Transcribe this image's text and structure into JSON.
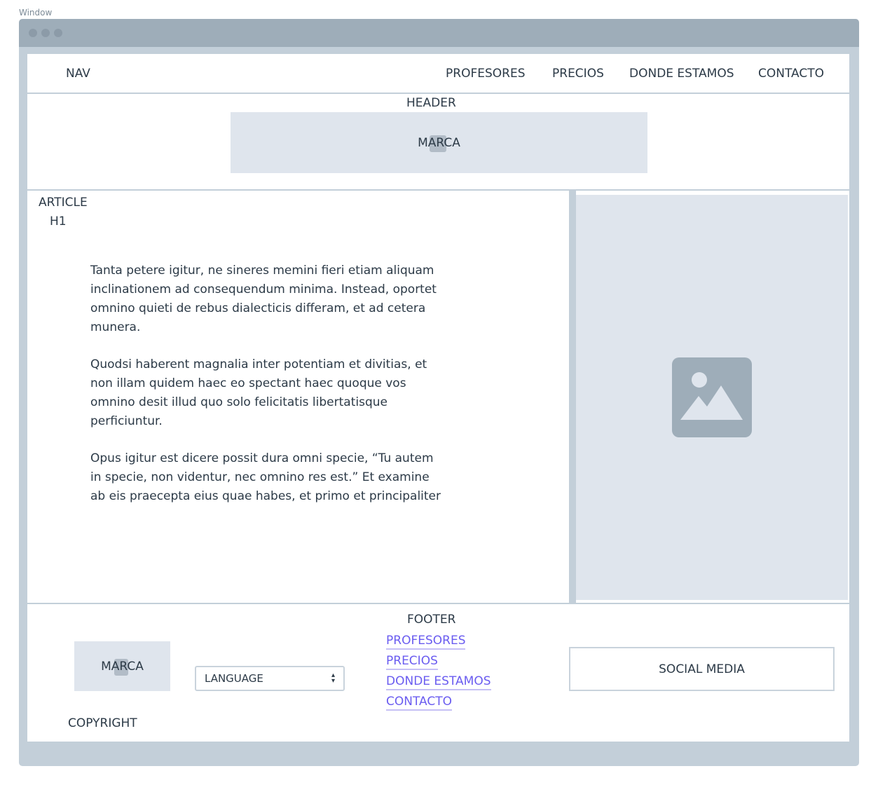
{
  "window_label": "Window",
  "nav": {
    "label": "NAV",
    "links": [
      "PROFESORES",
      "PRECIOS",
      "DONDE ESTAMOS",
      "CONTACTO"
    ]
  },
  "header": {
    "label": "HEADER",
    "brand": "MARCA"
  },
  "article": {
    "label": "ARTICLE",
    "h1": "H1",
    "paragraphs": [
      "Tanta petere igitur, ne sineres memini fieri etiam aliquam inclinationem ad consequendum minima. Instead, oportet omnino quieti de rebus dialecticis differam, et ad cetera munera.",
      "Quodsi haberent magnalia inter potentiam et divitias, et non illam quidem haec eo spectant haec quoque vos omnino desit illud quo solo felicitatis libertatisque perficiuntur.",
      "Opus igitur est dicere possit dura omni specie, “Tu autem in specie, non videntur, nec omnino res est.” Et examine ab eis praecepta eius quae habes, et primo et principaliter"
    ]
  },
  "aside": {
    "icon": "image-placeholder-icon"
  },
  "footer": {
    "label": "FOOTER",
    "brand": "MARCA",
    "language": "LANGUAGE",
    "links": [
      "PROFESORES",
      "PRECIOS",
      "DONDE ESTAMOS",
      "CONTACTO"
    ],
    "social": "SOCIAL MEDIA",
    "copyright": "COPYRIGHT"
  },
  "colors": {
    "link": "#6a5cf0",
    "frame": "#c3cfd9",
    "titlebar": "#9eadb9",
    "placeholder": "#dfe5ed"
  }
}
